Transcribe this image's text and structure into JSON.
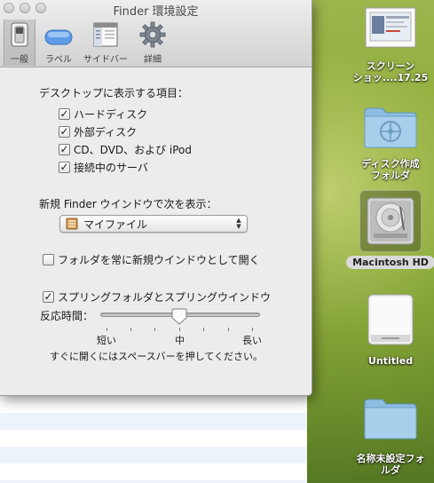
{
  "window": {
    "title": "Finder 環境設定"
  },
  "toolbar": {
    "tabs": [
      {
        "label": "一般",
        "icon": "switch-icon"
      },
      {
        "label": "ラベル",
        "icon": "label-icon"
      },
      {
        "label": "サイドバー",
        "icon": "sidebar-icon"
      },
      {
        "label": "詳細",
        "icon": "gear-icon"
      }
    ]
  },
  "desktop_section": {
    "title": "デスクトップに表示する項目：",
    "items": [
      {
        "label": "ハードディスク",
        "checked": true
      },
      {
        "label": "外部ディスク",
        "checked": true
      },
      {
        "label": "CD、DVD、および iPod",
        "checked": true
      },
      {
        "label": "接続中のサーバ",
        "checked": true
      }
    ]
  },
  "new_window": {
    "title": "新規 Finder ウインドウで次を表示：",
    "selected": "マイファイル"
  },
  "open_folders_in_new_window": {
    "label": "フォルダを常に新規ウインドウとして開く",
    "checked": false
  },
  "spring_loaded": {
    "label": "スプリングフォルダとスプリングウインドウ",
    "checked": true,
    "delay_label": "反応時間：",
    "marks": {
      "short": "短い",
      "medium": "中",
      "long": "長い"
    },
    "value": 0.5,
    "hint": "すぐに開くにはスペースバーを押してください。"
  },
  "desktop": {
    "items": [
      {
        "label_line1": "スクリーン",
        "label_line2": "ショッ....17.25",
        "icon": "screenshot-icon"
      },
      {
        "label_line1": "ディスク作成",
        "label_line2": "フォルダ",
        "icon": "burn-folder-icon"
      },
      {
        "label": "Macintosh HD",
        "icon": "hard-drive-icon"
      },
      {
        "label": "Untitled",
        "icon": "external-drive-icon"
      },
      {
        "label_line1": "名称未設定フォ",
        "label_line2": "ルダ",
        "icon": "folder-icon"
      }
    ]
  },
  "colors": {
    "window_bg": "#ececec",
    "desktop_green": "#7e9c33",
    "folder_blue": "#7fb3d9"
  }
}
